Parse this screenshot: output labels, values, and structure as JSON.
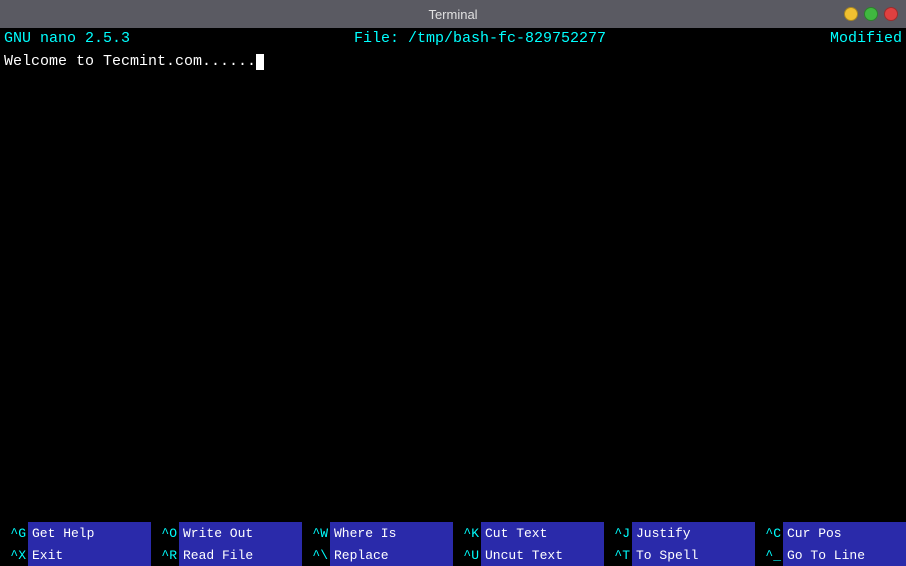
{
  "titlebar": {
    "title": "Terminal",
    "controls": [
      "minimize",
      "maximize",
      "close"
    ]
  },
  "nano": {
    "header": {
      "left": "GNU nano 2.5.3",
      "center": "File: /tmp/bash-fc-829752277",
      "right": "Modified"
    },
    "editor": {
      "content": "Welcome to Tecmint.com......"
    },
    "shortcuts": [
      [
        {
          "key": "^G",
          "label": "Get Help"
        },
        {
          "key": "^O",
          "label": "Write Out"
        },
        {
          "key": "^W",
          "label": "Where Is"
        },
        {
          "key": "^K",
          "label": "Cut Text"
        },
        {
          "key": "^J",
          "label": "Justify"
        },
        {
          "key": "^C",
          "label": "Cur Pos"
        }
      ],
      [
        {
          "key": "^X",
          "label": "Exit"
        },
        {
          "key": "^R",
          "label": "Read File"
        },
        {
          "key": "^\\",
          "label": "Replace"
        },
        {
          "key": "^U",
          "label": "Uncut Text"
        },
        {
          "key": "^T",
          "label": "To Spell"
        },
        {
          "key": "^_",
          "label": "Go To Line"
        }
      ]
    ]
  }
}
